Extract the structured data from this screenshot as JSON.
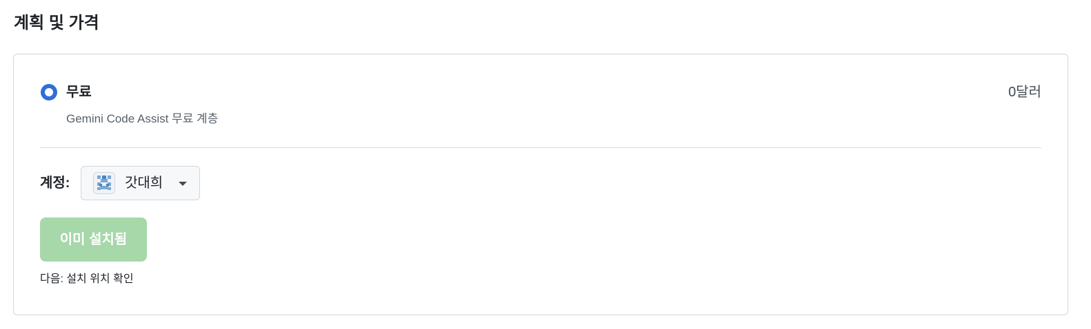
{
  "section": {
    "title": "계획 및 가격"
  },
  "plan": {
    "name": "무료",
    "price": "0달러",
    "description": "Gemini Code Assist 무료 계층",
    "selected": true
  },
  "account": {
    "label": "계정:",
    "name": "갓대희",
    "avatar_icon": "identicon-avatar"
  },
  "install_button": {
    "label": "이미 설치됨",
    "color": "#a6d8a9"
  },
  "next_step": {
    "text": "다음: 설치 위치 확인"
  },
  "colors": {
    "accent": "#2f6ed8",
    "border": "#d0d7de"
  }
}
